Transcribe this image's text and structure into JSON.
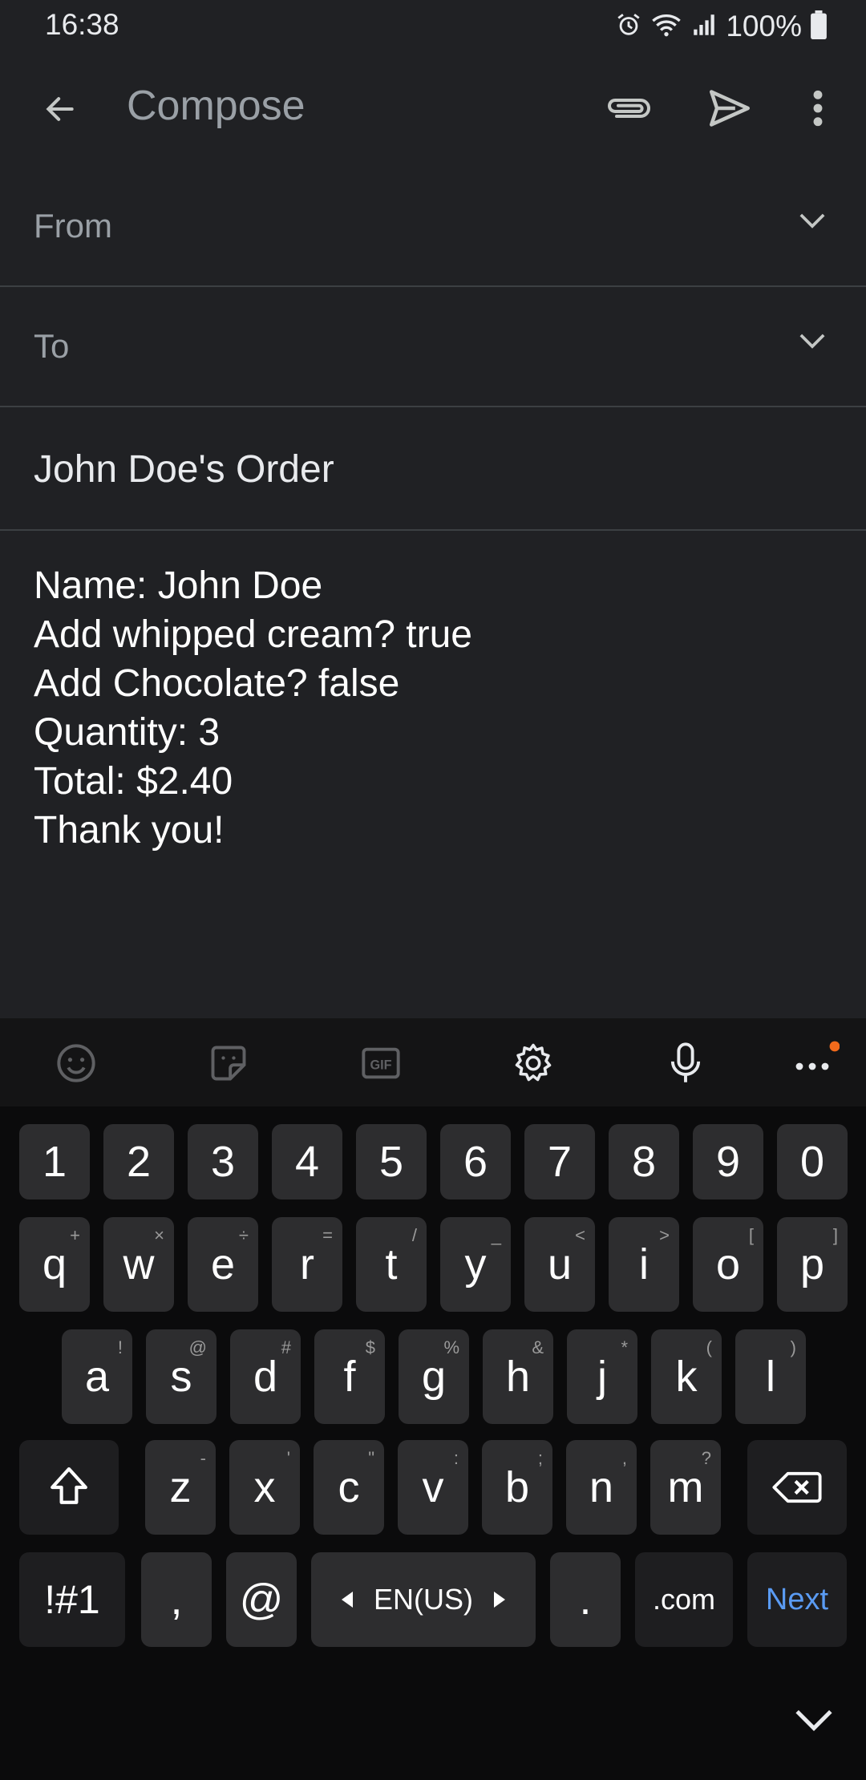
{
  "status_bar": {
    "time": "16:38",
    "battery": "100%"
  },
  "app_bar": {
    "title": "Compose"
  },
  "from_field": {
    "label": "From"
  },
  "to_field": {
    "label": "To"
  },
  "subject": "John Doe's Order",
  "body_lines": [
    "Name: John Doe",
    "Add whipped cream? true",
    "Add Chocolate? false",
    "Quantity: 3",
    "Total: $2.40",
    "Thank you!"
  ],
  "keyboard": {
    "number_row": [
      "1",
      "2",
      "3",
      "4",
      "5",
      "6",
      "7",
      "8",
      "9",
      "0"
    ],
    "row1": [
      {
        "key": "q",
        "sub": "+"
      },
      {
        "key": "w",
        "sub": "×"
      },
      {
        "key": "e",
        "sub": "÷"
      },
      {
        "key": "r",
        "sub": "="
      },
      {
        "key": "t",
        "sub": "/"
      },
      {
        "key": "y",
        "sub": "_"
      },
      {
        "key": "u",
        "sub": "<"
      },
      {
        "key": "i",
        "sub": ">"
      },
      {
        "key": "o",
        "sub": "["
      },
      {
        "key": "p",
        "sub": "]"
      }
    ],
    "row2": [
      {
        "key": "a",
        "sub": "!"
      },
      {
        "key": "s",
        "sub": "@"
      },
      {
        "key": "d",
        "sub": "#"
      },
      {
        "key": "f",
        "sub": "$"
      },
      {
        "key": "g",
        "sub": "%"
      },
      {
        "key": "h",
        "sub": "&"
      },
      {
        "key": "j",
        "sub": "*"
      },
      {
        "key": "k",
        "sub": "("
      },
      {
        "key": "l",
        "sub": ")"
      }
    ],
    "row3": [
      {
        "key": "z",
        "sub": "-"
      },
      {
        "key": "x",
        "sub": "'"
      },
      {
        "key": "c",
        "sub": "\""
      },
      {
        "key": "v",
        "sub": ":"
      },
      {
        "key": "b",
        "sub": ";"
      },
      {
        "key": "n",
        "sub": ","
      },
      {
        "key": "m",
        "sub": "?"
      }
    ],
    "symbols_label": "!#1",
    "comma": ",",
    "at": "@",
    "language": "EN(US)",
    "period": ".",
    "dotcom": ".com",
    "next_label": "Next"
  },
  "icons": {
    "toolbar": [
      "emoji-icon",
      "sticker-icon",
      "gif-icon",
      "settings-icon",
      "microphone-icon",
      "more-icon"
    ],
    "accent_dot_color": "#f26a1b"
  }
}
